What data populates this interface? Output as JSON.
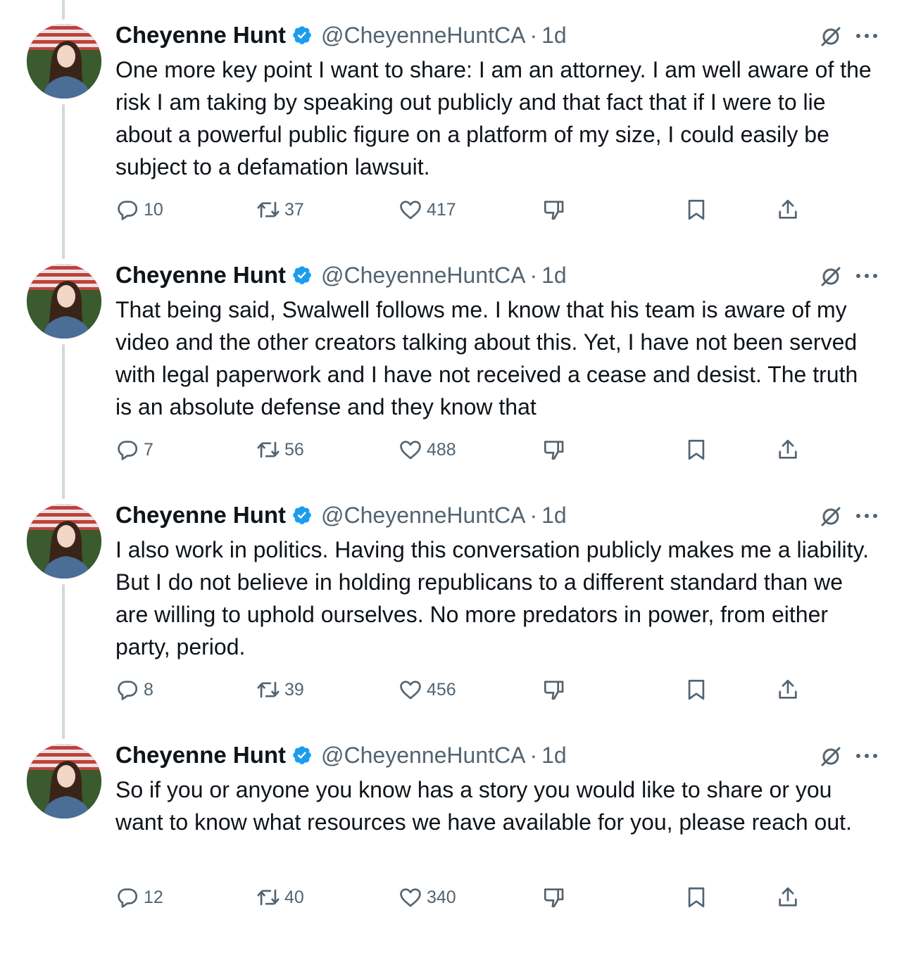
{
  "tweets": [
    {
      "name": "Cheyenne Hunt",
      "handle": "@CheyenneHuntCA",
      "separator": "·",
      "time": "1d",
      "text": "One more key point I want to share: I am an attorney. I am well aware of the risk I am taking by speaking out publicly and that fact that if I were to lie about a powerful public figure on a platform of my size, I could easily be subject to a defamation lawsuit.",
      "replies": "10",
      "reposts": "37",
      "likes": "417"
    },
    {
      "name": "Cheyenne Hunt",
      "handle": "@CheyenneHuntCA",
      "separator": "·",
      "time": "1d",
      "text": "That being said, Swalwell follows me. I know that his team is aware of my video and the other creators talking about this. Yet, I have not been served with legal paperwork and I have not received a cease and desist. The truth is an absolute defense and they know that",
      "replies": "7",
      "reposts": "56",
      "likes": "488"
    },
    {
      "name": "Cheyenne Hunt",
      "handle": "@CheyenneHuntCA",
      "separator": "·",
      "time": "1d",
      "text": "I also work in politics. Having this conversation publicly makes me a liability. But I do not believe in holding republicans to a different standard than we are willing to uphold ourselves. No more predators in power, from either party, period.",
      "replies": "8",
      "reposts": "39",
      "likes": "456"
    },
    {
      "name": "Cheyenne Hunt",
      "handle": "@CheyenneHuntCA",
      "separator": "·",
      "time": "1d",
      "text": "So if you or anyone you know has a story you would like to share or you want to know what resources we have available for you, please reach out.",
      "replies": "12",
      "reposts": "40",
      "likes": "340"
    }
  ],
  "icons": {
    "verified": "verified-badge-icon",
    "grok": "grok-icon",
    "more": "more-icon",
    "reply": "reply-icon",
    "repost": "repost-icon",
    "like": "like-icon",
    "dislike": "dislike-icon",
    "bookmark": "bookmark-icon",
    "share": "share-icon"
  },
  "colors": {
    "verified": "#1d9bf0",
    "secondary_text": "#536471",
    "thread_line": "#cfd9de"
  }
}
